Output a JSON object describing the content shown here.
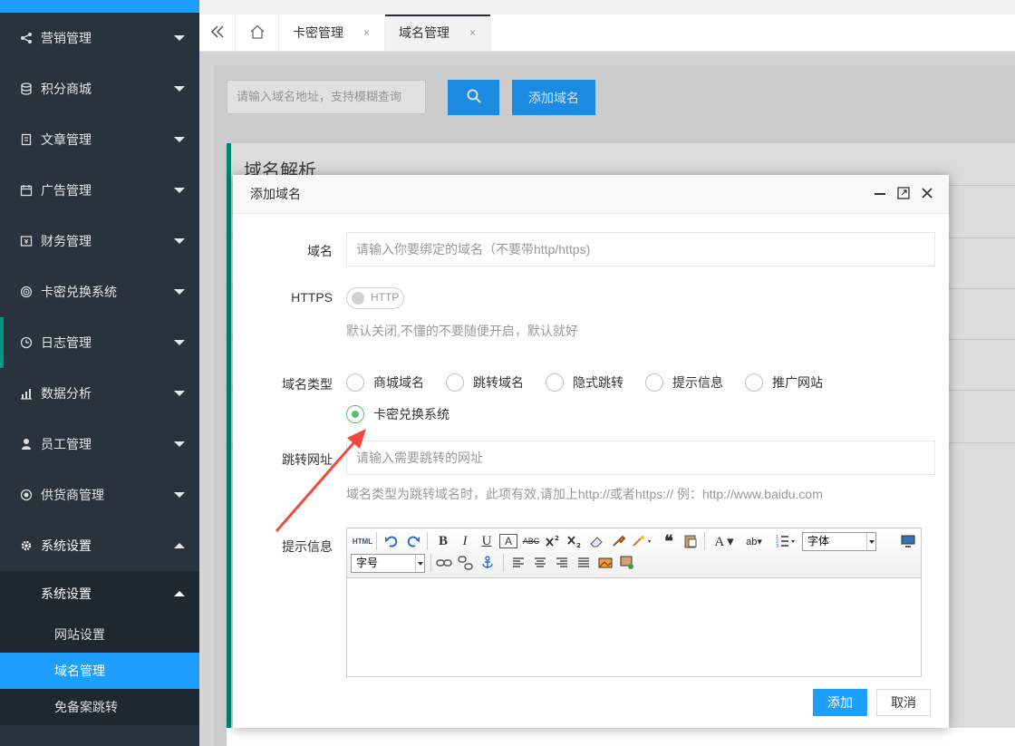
{
  "sidebar": {
    "items": [
      {
        "label": "营销管理",
        "icon": "share-icon"
      },
      {
        "label": "积分商城",
        "icon": "database-icon"
      },
      {
        "label": "文章管理",
        "icon": "document-icon"
      },
      {
        "label": "广告管理",
        "icon": "calendar-icon"
      },
      {
        "label": "财务管理",
        "icon": "wallet-icon"
      },
      {
        "label": "卡密兑换系统",
        "icon": "target-icon"
      },
      {
        "label": "日志管理",
        "icon": "clock-icon"
      },
      {
        "label": "数据分析",
        "icon": "chart-icon"
      },
      {
        "label": "员工管理",
        "icon": "user-icon"
      },
      {
        "label": "供货商管理",
        "icon": "supplier-icon"
      },
      {
        "label": "系统设置",
        "icon": "gear-icon"
      }
    ],
    "sub_head": "系统设置",
    "sub_items": [
      "网站设置",
      "域名管理",
      "免备案跳转"
    ]
  },
  "tabs": {
    "items": [
      {
        "label": "卡密管理",
        "close": "×"
      },
      {
        "label": "域名管理",
        "close": "×"
      }
    ]
  },
  "content": {
    "search_placeholder": "请输入域名地址，支持模糊查询",
    "add_button": "添加域名",
    "panel_title": "域名解析"
  },
  "modal": {
    "title": "添加域名",
    "domain_label": "域名",
    "domain_placeholder": "请输入你要绑定的域名（不要带http/https)",
    "https_label": "HTTPS",
    "https_switch_text": "HTTP",
    "https_hint": "默认关闭,不懂的不要随便开启，默认就好",
    "type_label": "域名类型",
    "type_options": [
      "商城域名",
      "跳转域名",
      "隐式跳转",
      "提示信息",
      "推广网站",
      "卡密兑换系统"
    ],
    "selected_type": "卡密兑换系统",
    "redirect_label": "跳转网址",
    "redirect_placeholder": "请输入需要跳转的网址",
    "redirect_hint": "域名类型为跳转域名时，此项有效,请加上http://或者https:// 例：http://www.baidu.com",
    "message_label": "提示信息",
    "editor": {
      "html_label": "HTML",
      "font_select": "字体",
      "size_select": "字号"
    },
    "submit_button": "添加",
    "cancel_button": "取消"
  },
  "colors": {
    "sidebar_bg": "#28333e",
    "accent": "#1e9fff",
    "radio_on": "#5fb878",
    "annotation_arrow": "#f04a3a"
  }
}
